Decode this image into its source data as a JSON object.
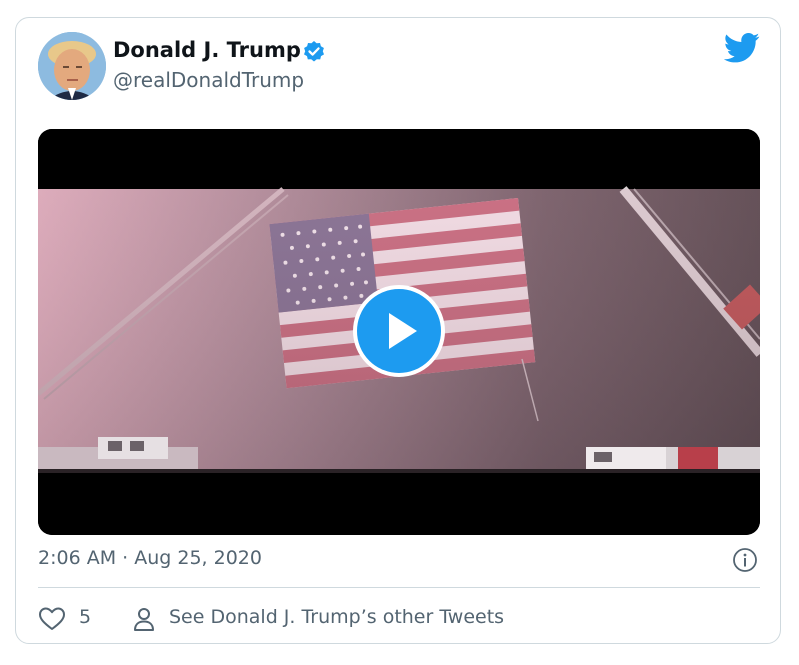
{
  "tweet": {
    "author_name": "Donald J. Trump",
    "handle": "@realDonaldTrump",
    "verified": true,
    "timestamp": "2:06 AM · Aug 25, 2020",
    "like_count": "5",
    "profile_link_label": "See Donald J. Trump’s other Tweets"
  },
  "media": {
    "type": "video"
  },
  "icons": {
    "brand": "twitter-bird-icon",
    "verified": "verified-badge-icon",
    "play": "play-icon",
    "info": "info-icon",
    "like": "heart-icon",
    "profile": "person-icon"
  },
  "colors": {
    "brand": "#1d9bf0",
    "text": "#0f1419",
    "secondary": "#536471",
    "border": "#cfd9de"
  }
}
